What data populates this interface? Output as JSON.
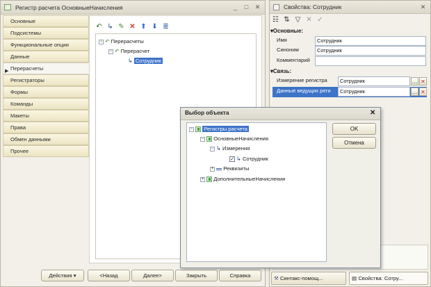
{
  "main_window": {
    "title": "Регистр расчета ОсновныеНачисления",
    "title_buttons": [
      "_",
      "□",
      "✕"
    ],
    "tabs": [
      {
        "label": "Основные",
        "active": false
      },
      {
        "label": "Подсистемы",
        "active": false
      },
      {
        "label": "Функциональные опции",
        "active": false
      },
      {
        "label": "Данные",
        "active": false
      },
      {
        "label": "Перерасчеты",
        "active": true
      },
      {
        "label": "Регистраторы",
        "active": false
      },
      {
        "label": "Формы",
        "active": false
      },
      {
        "label": "Команды",
        "active": false
      },
      {
        "label": "Макеты",
        "active": false
      },
      {
        "label": "Права",
        "active": false
      },
      {
        "label": "Обмен данными",
        "active": false
      },
      {
        "label": "Прочее",
        "active": false
      }
    ],
    "toolbar_icons": [
      "arrow-add-icon",
      "add-dimension-icon",
      "edit-pencil-icon",
      "delete-icon",
      "move-up-icon",
      "move-down-icon",
      "sort-icon"
    ],
    "tree": {
      "root": "Перерасчеты",
      "child": "Перерасчет",
      "leaf": "Сотрудник"
    },
    "buttons": {
      "actions": "Действия",
      "back": "<Назад",
      "next": "Далее>",
      "close": "Закрыть",
      "help": "Справка"
    }
  },
  "properties": {
    "title": "Свойства: Сотрудник",
    "sections": {
      "main": "Основные:",
      "link": "Связь:"
    },
    "fields": {
      "name": {
        "label": "Имя",
        "value": "Сотрудник"
      },
      "synonym": {
        "label": "Синоним",
        "value": "Сотрудник"
      },
      "comment": {
        "label": "Комментарий",
        "value": ""
      },
      "register_dimension": {
        "label": "Измерение регистра",
        "value": "Сотрудник"
      },
      "leading_data": {
        "label": "Данные ведущих реги",
        "value": "Сотрудник"
      }
    },
    "bottom_tabs": [
      "Синтакс-помощ...",
      "Свойства: Сотру..."
    ]
  },
  "dialog": {
    "title": "Выбор объекта",
    "ok": "OK",
    "cancel": "Отмена",
    "tree": {
      "root": "Регистры расчета",
      "main_accruals": "ОсновныеНачисления",
      "dimensions": "Измерения",
      "employee": "Сотрудник",
      "attributes": "Реквизиты",
      "extra_accruals": "ДополнительныеНачисления"
    }
  },
  "colors": {
    "selection": "#3d73c8",
    "tab_gradient": "#ece4c2",
    "window_bg": "#f2f0e8"
  }
}
